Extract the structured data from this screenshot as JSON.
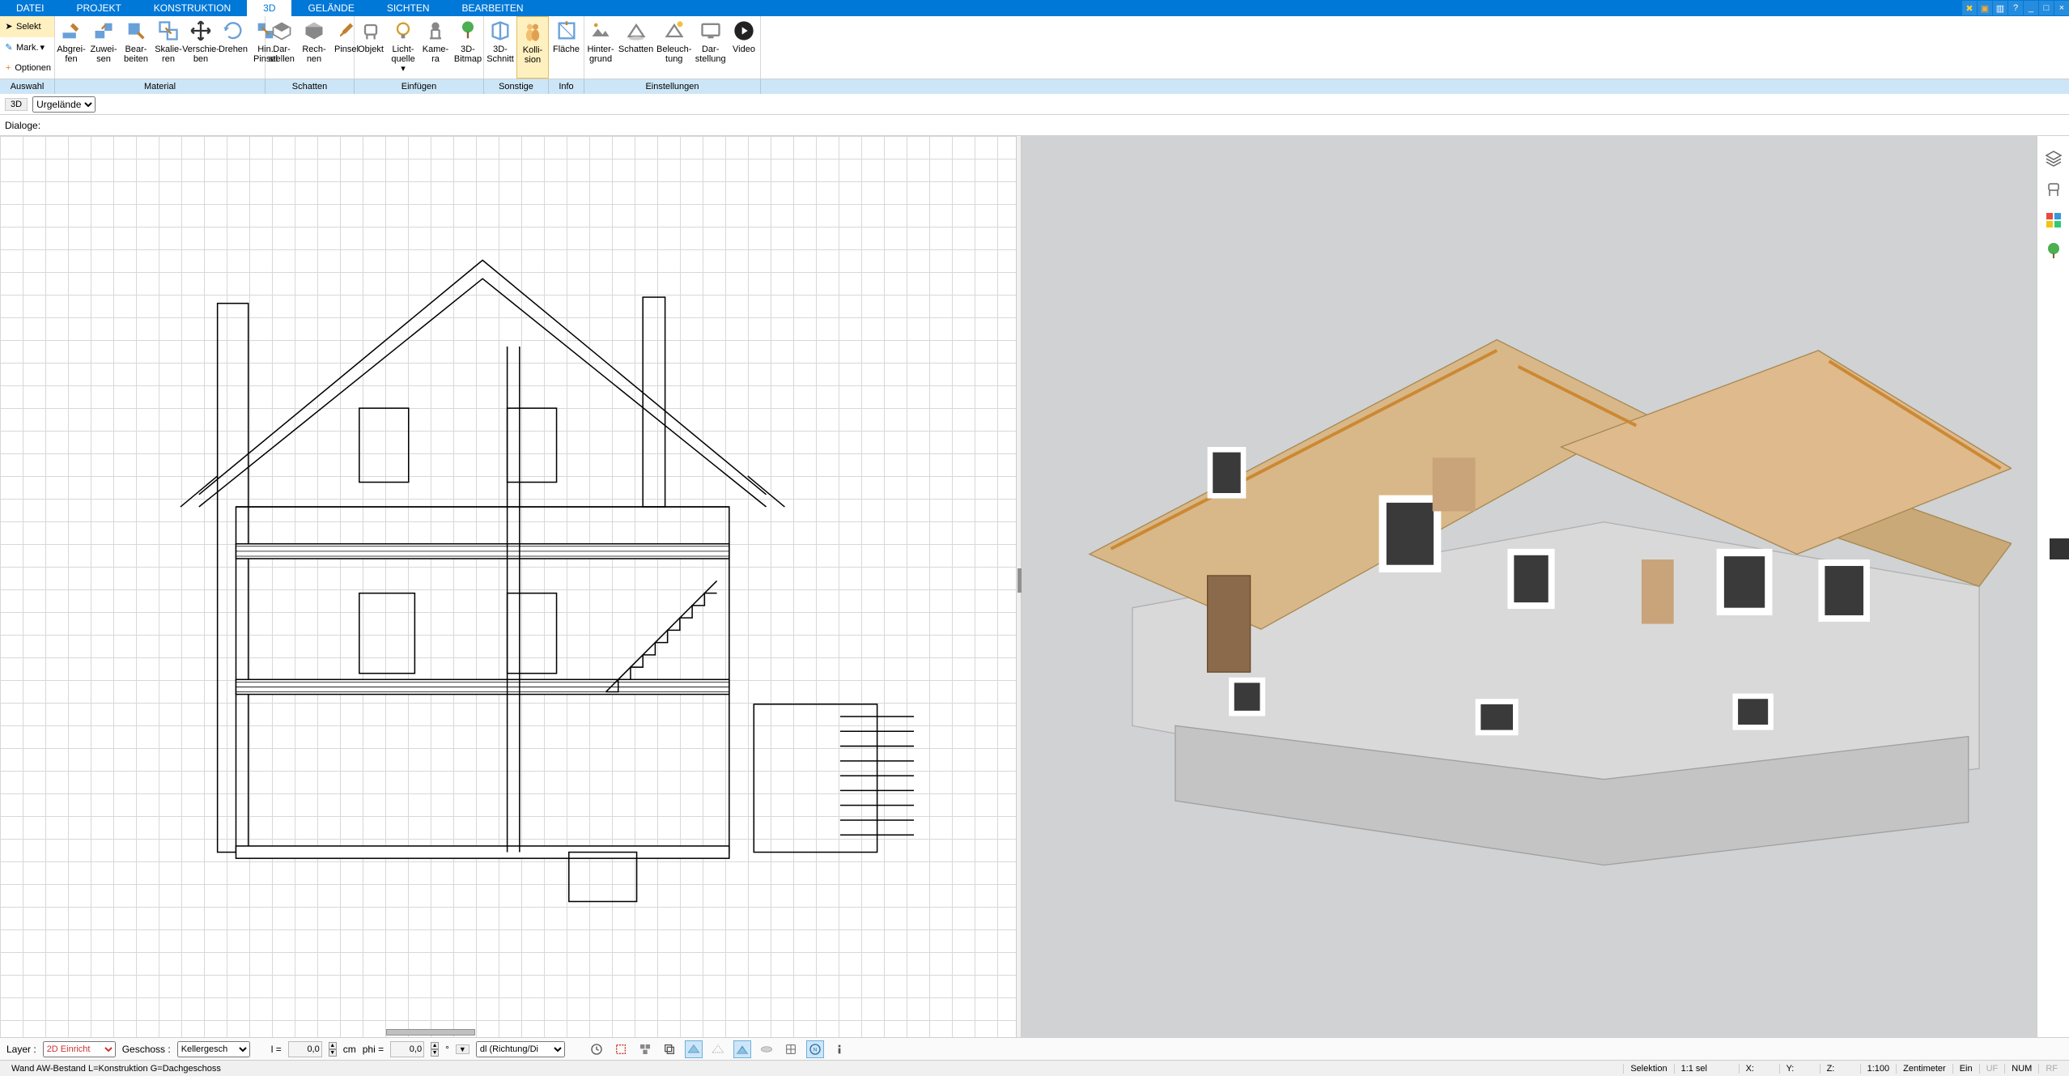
{
  "menu": {
    "tabs": [
      "DATEI",
      "PROJEKT",
      "KONSTRUKTION",
      "3D",
      "GELÄNDE",
      "SICHTEN",
      "BEARBEITEN"
    ],
    "active_index": 3
  },
  "ribbon_left": {
    "selekt": "Selekt",
    "mark": "Mark.",
    "optionen": "Optionen"
  },
  "ribbon": {
    "material": [
      {
        "name": "abgreifen",
        "l1": "Abgrei-",
        "l2": "fen"
      },
      {
        "name": "zuweisen",
        "l1": "Zuwei-",
        "l2": "sen"
      },
      {
        "name": "bearbeiten",
        "l1": "Bear-",
        "l2": "beiten"
      },
      {
        "name": "skalieren",
        "l1": "Skalie-",
        "l2": "ren"
      },
      {
        "name": "verschieben",
        "l1": "Verschie-",
        "l2": "ben"
      },
      {
        "name": "drehen",
        "l1": "Drehen",
        "l2": ""
      },
      {
        "name": "hinpinsel",
        "l1": "Hin.",
        "l2": "Pinsel"
      }
    ],
    "schatten": [
      {
        "name": "darstellen",
        "l1": "Dar-",
        "l2": "stellen"
      },
      {
        "name": "rechnen",
        "l1": "Rech-",
        "l2": "nen"
      },
      {
        "name": "pinsel",
        "l1": "Pinsel",
        "l2": ""
      }
    ],
    "einfuegen": [
      {
        "name": "objekt",
        "l1": "Objekt",
        "l2": ""
      },
      {
        "name": "lichtquelle",
        "l1": "Licht-",
        "l2": "quelle ▾"
      },
      {
        "name": "kamera",
        "l1": "Kame-",
        "l2": "ra"
      },
      {
        "name": "3dbitmap",
        "l1": "3D-",
        "l2": "Bitmap"
      }
    ],
    "sonstige": [
      {
        "name": "3dschnitt",
        "l1": "3D-",
        "l2": "Schnitt"
      },
      {
        "name": "kollision",
        "l1": "Kolli-",
        "l2": "sion",
        "active": true
      }
    ],
    "info": [
      {
        "name": "flaeche",
        "l1": "Fläche",
        "l2": ""
      }
    ],
    "einstellungen": [
      {
        "name": "hintergrund",
        "l1": "Hinter-",
        "l2": "grund"
      },
      {
        "name": "schatten2",
        "l1": "Schatten",
        "l2": ""
      },
      {
        "name": "beleuchtung",
        "l1": "Beleuch-",
        "l2": "tung"
      },
      {
        "name": "darstellung",
        "l1": "Dar-",
        "l2": "stellung"
      },
      {
        "name": "video",
        "l1": "Video",
        "l2": ""
      }
    ]
  },
  "group_labels": {
    "auswahl": "Auswahl",
    "material": "Material",
    "schatten": "Schatten",
    "einfuegen": "Einfügen",
    "sonstige": "Sonstige",
    "info": "Info",
    "einstellungen": "Einstellungen"
  },
  "subbar": {
    "mode": "3D",
    "view_options": [
      "Urgelände"
    ],
    "view_selected": "Urgelände",
    "dialoge_label": "Dialoge:"
  },
  "bottombar": {
    "layer_label": "Layer :",
    "layer_value": "2D Einricht",
    "geschoss_label": "Geschoss :",
    "geschoss_value": "Kellergesch",
    "l_label": "l =",
    "l_value": "0,0",
    "l_unit": "cm",
    "phi_label": "phi =",
    "phi_value": "0,0",
    "phi_unit": "°",
    "dl_value": "dl (Richtung/Di"
  },
  "statusbar": {
    "left": "Wand AW-Bestand L=Konstruktion G=Dachgeschoss",
    "selektion": "Selektion",
    "sel": "1:1 sel",
    "x": "X:",
    "y": "Y:",
    "z": "Z:",
    "scale": "1:100",
    "unit": "Zentimeter",
    "ein": "Ein",
    "uf": "UF",
    "num": "NUM",
    "rf": "RF"
  }
}
